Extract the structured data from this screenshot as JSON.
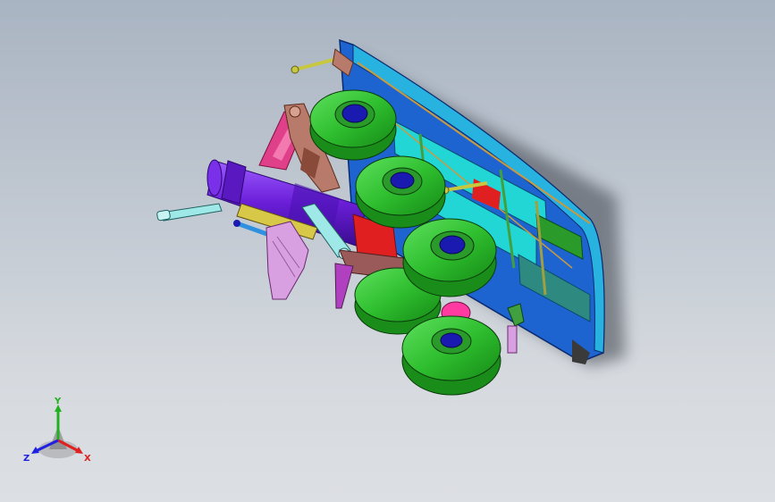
{
  "viewport": {
    "background_top": "#a9b4c2",
    "background_bottom": "#dcdfe3"
  },
  "model": {
    "description_colors": {
      "tire": "#2fbf2f",
      "tire_dark": "#198c19",
      "hub": "#1a1ab0",
      "cylinder": "#6a1ed8",
      "door_panel": "#1e64d0",
      "door_cyan": "#23d6d6",
      "strut_pink": "#e0408a",
      "bracket_brown": "#b87a6a",
      "light_cyan": "#9fe8e8",
      "lavender": "#d8a0e0",
      "red": "#e02020",
      "yellow": "#d8c848",
      "magenta": "#e020a0"
    }
  },
  "triad": {
    "x_label": "X",
    "y_label": "Y",
    "z_label": "Z",
    "x_color": "#e02020",
    "y_color": "#20b020",
    "z_color": "#2020e0"
  }
}
